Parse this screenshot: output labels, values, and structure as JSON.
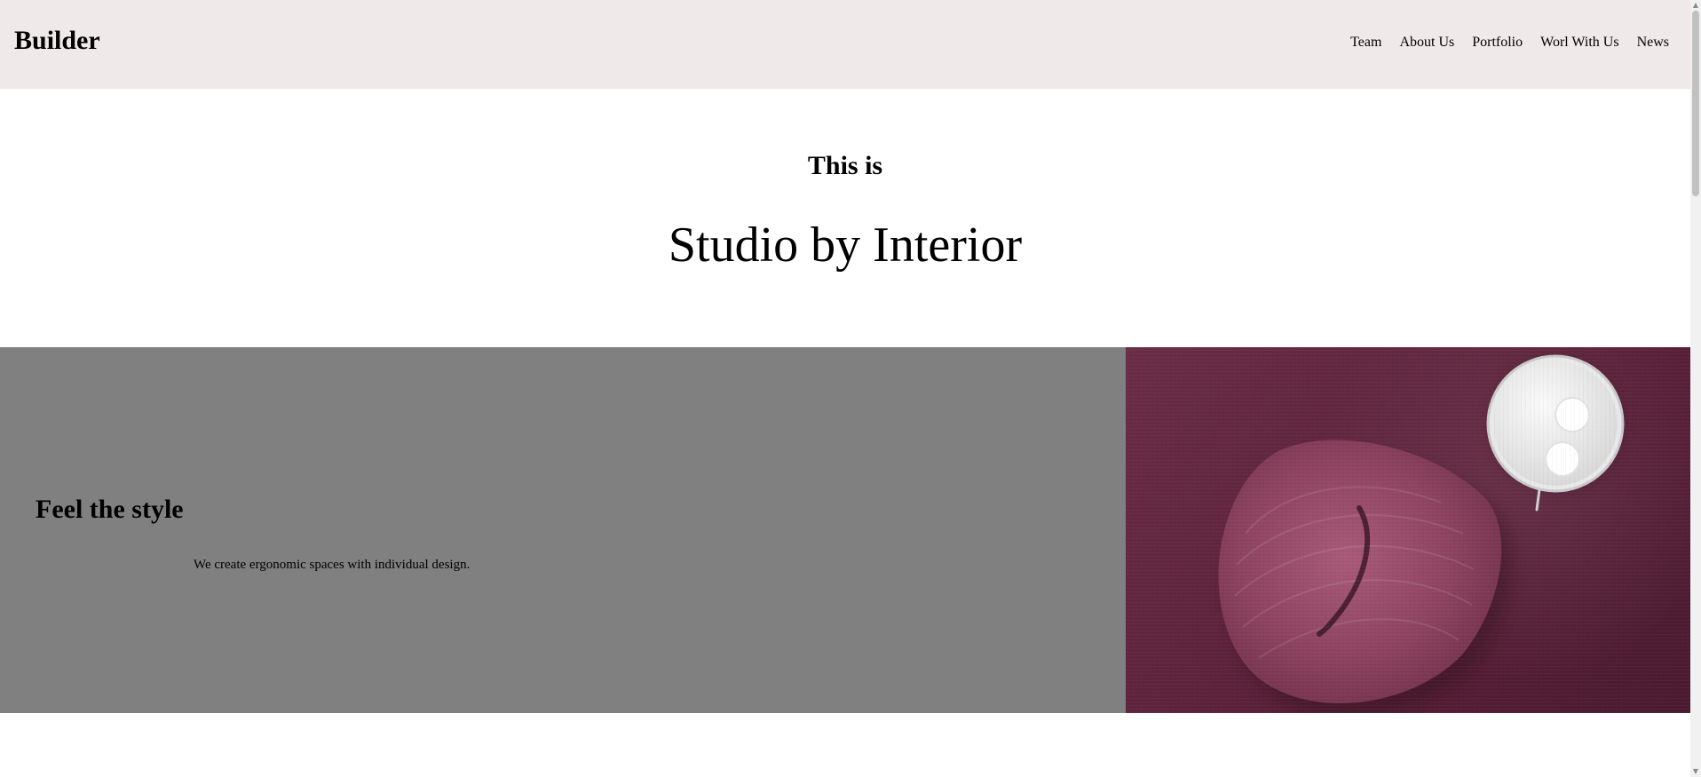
{
  "header": {
    "logo": "Builder",
    "nav": [
      {
        "label": "Team"
      },
      {
        "label": "About Us"
      },
      {
        "label": "Portfolio"
      },
      {
        "label": "Worl With Us"
      },
      {
        "label": "News"
      }
    ]
  },
  "hero": {
    "kicker": "This is",
    "title": "Studio by Interior"
  },
  "feature": {
    "title": "Feel the style",
    "text": "We create ergonomic spaces with individual design.",
    "image_icon": "chair-image-icon"
  },
  "colors": {
    "header_bg": "#efe9e9",
    "feature_bg": "#808080",
    "image_plum": "#5a2039",
    "chair_pink": "#9a4f6b",
    "table_white": "#f3f3f3"
  },
  "scrollbar": {
    "up_icon": "chevron-up-icon",
    "down_icon": "chevron-down-icon"
  }
}
